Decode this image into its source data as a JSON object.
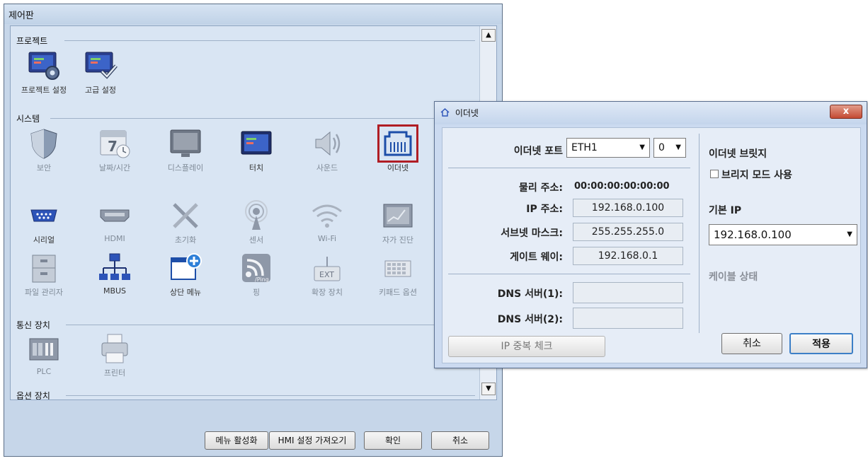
{
  "control_panel": {
    "title": "제어판",
    "sections": {
      "project": "프로젝트",
      "system": "시스템",
      "comm": "통신 장치",
      "option": "옵션 장치"
    },
    "project_items": [
      "프로젝트 설정",
      "고급 설정"
    ],
    "system_items": [
      "보안",
      "날짜/시간",
      "디스플레이",
      "터치",
      "사운드",
      "이더넷",
      "시리얼",
      "HDMI",
      "초기화",
      "센서",
      "Wi-Fi",
      "자가 진단",
      "파일 관리자",
      "MBUS",
      "상단 메뉴",
      "핑",
      "확장 장치",
      "키패드 옵션"
    ],
    "comm_items": [
      "PLC",
      "프린터"
    ],
    "icon_text": {
      "calendar_day": "7",
      "ping": "/Ping",
      "ext": "EXT"
    },
    "buttons": {
      "menu_enable": "메뉴 활성화",
      "hmi_import": "HMI 설정 가져오기",
      "ok": "확인",
      "cancel": "취소"
    }
  },
  "ethernet_dialog": {
    "title": "이더넷",
    "port_label": "이더넷 포트",
    "port_value": "ETH1",
    "port_index": "0",
    "mac_label": "물리 주소:",
    "mac_value": "00:00:00:00:00:00",
    "ip_label": "IP 주소:",
    "ip_value": "192.168.0.100",
    "subnet_label": "서브넷 마스크:",
    "subnet_value": "255.255.255.0",
    "gateway_label": "게이트 웨이:",
    "gateway_value": "192.168.0.1",
    "dns1_label": "DNS 서버(1):",
    "dns1_value": "",
    "dns2_label": "DNS 서버(2):",
    "dns2_value": "",
    "bridge_label": "이더넷 브릿지",
    "bridge_mode_label": "브리지 모드 사용",
    "default_ip_label": "기본 IP",
    "default_ip_value": "192.168.0.100",
    "cable_status_label": "케이블 상태",
    "ip_check_button": "IP 중복 체크",
    "cancel_button": "취소",
    "apply_button": "적용",
    "close_symbol": "x"
  }
}
